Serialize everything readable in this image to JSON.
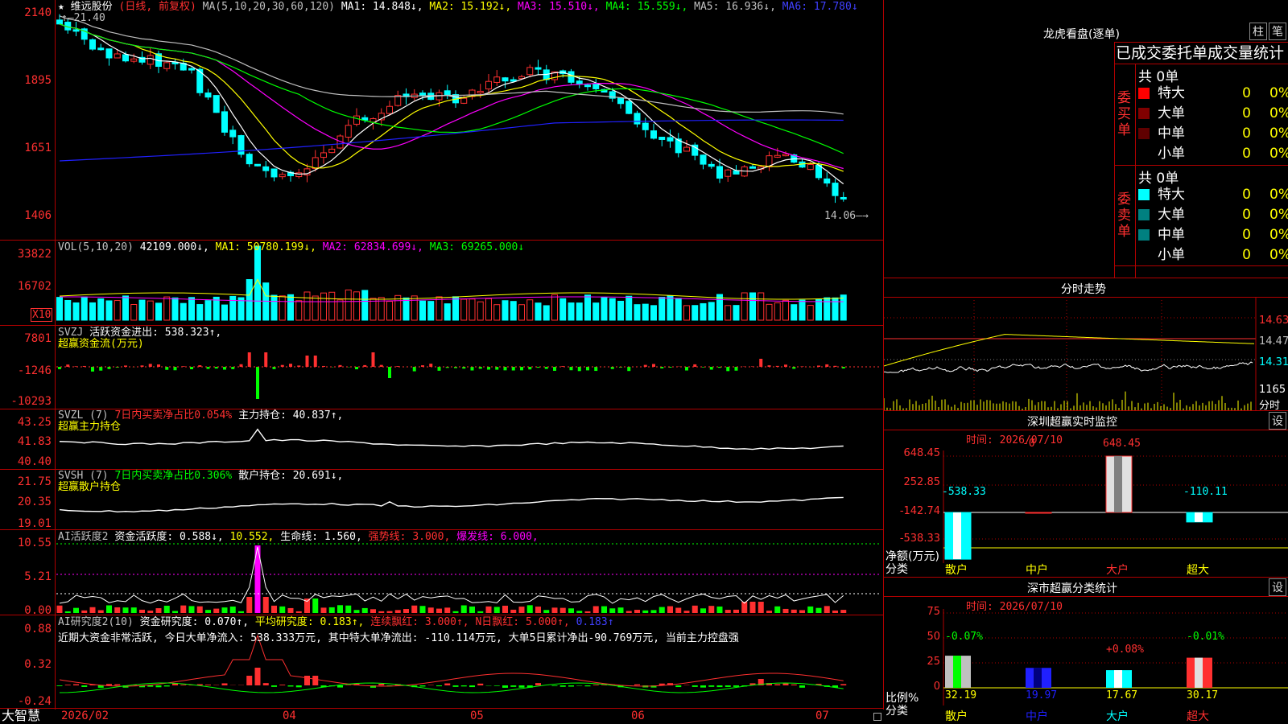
{
  "colors": {
    "up": "#ff3030",
    "down": "#00ffff",
    "ma1": "#ffffff",
    "ma2": "#ffff00",
    "ma3": "#ff00ff",
    "ma4": "#00ff00",
    "ma5": "#c0c0c0",
    "ma6": "#4040ff",
    "frame": "#b00000"
  },
  "main": {
    "y_labels": [
      "2140",
      "1895",
      "1651",
      "1406"
    ],
    "header": {
      "star": "★",
      "name": "维远股份",
      "mode": "(日线, 前复权)",
      "ma_params": "MA(5,10,20,30,60,120)",
      "ma1": "MA1: 14.848↓,",
      "ma2": "MA2: 15.192↓,",
      "ma3": "MA3: 15.510↓,",
      "ma4": "MA4: 15.559↓,",
      "ma5": "MA5: 16.936↓,",
      "ma6": "MA6: 17.780↓"
    },
    "high_mark": "21.40",
    "low_mark": "14.06"
  },
  "vol": {
    "y_labels": [
      "33822",
      "16702"
    ],
    "unit": "X10",
    "header": {
      "params": "VOL(5,10,20)",
      "value": "42109.000↓,",
      "ma1": "MA1: 50780.199↓,",
      "ma2": "MA2: 62834.699↓,",
      "ma3": "MA3: 69265.000↓"
    }
  },
  "svzj": {
    "y_labels": [
      "7801",
      "-1246",
      "-10293"
    ],
    "header": {
      "name": "SVZJ",
      "desc": "活跃资金进出: 538.323↑,",
      "sub": "超赢资金流(万元)"
    }
  },
  "svzl": {
    "y_labels": [
      "43.25",
      "41.83",
      "40.40"
    ],
    "header": {
      "name": "SVZL (7)",
      "desc": "7日内买卖净占比0.054%",
      "hold": "主力持仓: 40.837↑,",
      "sub": "超赢主力持仓"
    }
  },
  "svsh": {
    "y_labels": [
      "21.75",
      "20.35",
      "19.01"
    ],
    "header": {
      "name": "SVSH (7)",
      "desc": "7日内买卖净占比0.306%",
      "hold": "散户持仓: 20.691↓,",
      "sub": "超赢散户持仓"
    }
  },
  "ai1": {
    "y_labels": [
      "10.55",
      "5.21",
      "0.00"
    ],
    "header": {
      "name": "AI活跃度2",
      "act": "资金活跃度: 0.588↓,",
      "val2": "10.552,",
      "life": "生命线: 1.560,",
      "strong": "强势线: 3.000,",
      "burst": "爆发线: 6.000,"
    }
  },
  "ai2": {
    "y_labels": [
      "0.88",
      "0.32",
      "-0.24"
    ],
    "header": {
      "name": "AI研究度2(10)",
      "res": "资金研究度: 0.070↑,",
      "avg": "平均研究度: 0.183↑,",
      "red": "连续飘红: 3.000↑,",
      "nred": "N日飘红: 5.000↑,",
      "last": "0.183↑"
    },
    "comment": "近期大资金非常活跃, 今日大单净流入: 538.333万元, 其中特大单净流出: -110.114万元, 大单5日累计净出-90.769万元, 当前主力控盘强"
  },
  "xaxis": {
    "logo": "大智慧",
    "labels": [
      "2026/02",
      "04",
      "05",
      "06",
      "07"
    ]
  },
  "dragon": {
    "title": "龙虎看盘(逐单)",
    "btn1": "柱",
    "btn2": "笔",
    "subtitle": "已成交委托单成交量统计",
    "buy": {
      "side": "委买单",
      "total": "共 0单",
      "rows": [
        {
          "name": "特大",
          "count": "0",
          "pct": "0%",
          "color": "#ff0000"
        },
        {
          "name": "大单",
          "count": "0",
          "pct": "0%",
          "color": "#800000"
        },
        {
          "name": "中单",
          "count": "0",
          "pct": "0%",
          "color": "#600000"
        },
        {
          "name": "小单",
          "count": "0",
          "pct": "0%",
          "color": ""
        }
      ]
    },
    "sell": {
      "side": "委卖单",
      "total": "共 0单",
      "rows": [
        {
          "name": "特大",
          "count": "0",
          "pct": "0%",
          "color": "#00ffff"
        },
        {
          "name": "大单",
          "count": "0",
          "pct": "0%",
          "color": "#008080"
        },
        {
          "name": "中单",
          "count": "0",
          "pct": "0%",
          "color": "#008080"
        },
        {
          "name": "小单",
          "count": "0",
          "pct": "0%",
          "color": ""
        }
      ]
    }
  },
  "intraday": {
    "title": "分时走势",
    "prices": [
      "14.63",
      "14.47",
      "14.31"
    ],
    "vol_label": "1165",
    "vol_unit": "分时"
  },
  "monitor": {
    "title": "深圳超赢实时监控",
    "btn": "设",
    "time": "时间: 2026/07/10",
    "y_labels": [
      "648.45",
      "252.85",
      "-142.74",
      "-538.33"
    ],
    "y_title": "净额(万元)",
    "x_title": "分类",
    "cats": [
      "散户",
      "中户",
      "大户",
      "超大"
    ],
    "values": [
      "-538.33",
      "-0",
      "648.45",
      "-110.11"
    ]
  },
  "classify": {
    "title": "深市超赢分类统计",
    "btn": "设",
    "time": "时间: 2026/07/10",
    "y_labels": [
      "75",
      "50",
      "25",
      "0"
    ],
    "y_title": "比例%",
    "x_title": "分类",
    "cats": [
      "散户",
      "中户",
      "大户",
      "超大"
    ],
    "values": [
      "32.19",
      "19.97",
      "17.67",
      "30.17"
    ],
    "changes": [
      "-0.07%",
      "",
      "+0.08%",
      "-0.01%"
    ]
  }
}
